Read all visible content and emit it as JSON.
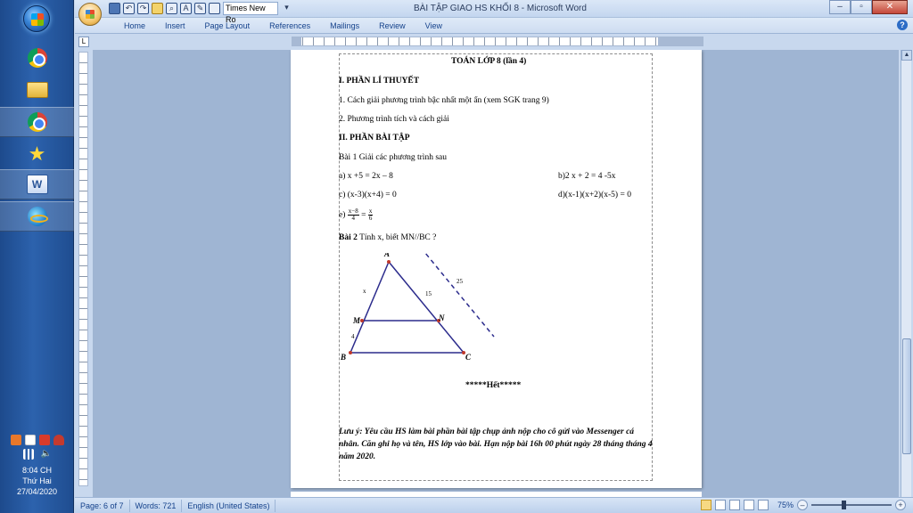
{
  "taskbar": {
    "clock": {
      "time": "8:04 CH",
      "day": "Thứ Hai",
      "date": "27/04/2020"
    }
  },
  "word": {
    "title": "BÀI TẬP GIAO HS KHỐI 8 - Microsoft Word",
    "font_name": "Times New Ro",
    "menu": [
      "Home",
      "Insert",
      "Page Layout",
      "References",
      "Mailings",
      "Review",
      "View"
    ],
    "status": {
      "page": "Page: 6 of 7",
      "words": "Words: 721",
      "language": "English (United States)",
      "zoom": "75%"
    }
  },
  "document": {
    "heading": "TOÁN LỚP 8 (lần 4)",
    "sec1": "I. PHẦN LÍ THUYẾT",
    "t1": "1. Cách giải phương trình bậc nhất một ẩn (xem SGK trang 9)",
    "t2": "2. Phương trình tích và cách  giải",
    "sec2": "II. PHẦN BÀI TẬP",
    "bai1": "Bài 1 Giải các phương trình sau",
    "a": "a) x +5  = 2x – 8",
    "b": "b)2 x + 2 = 4 -5x",
    "c": "c) (x-3)(x+4) = 0",
    "d": "d)(x-1)(x+2)(x-5) = 0",
    "e_prefix": "e)",
    "e_num1": "x−8",
    "e_den1": "4",
    "e_eq": "=",
    "e_num2": "x",
    "e_den2": "6",
    "bai2_label": "Bài 2",
    "bai2_text": " Tính x, biết MN//BC ?",
    "fig": {
      "A": "A",
      "B": "B",
      "C": "C",
      "M": "M",
      "N": "N",
      "x": "x",
      "n15": "15",
      "n4": "4",
      "n25": "25"
    },
    "end": "*****Hết*****",
    "note": "Lưu ý: Yêu cầu HS làm bài phần bài tập chụp ảnh nộp cho cô gửi vào Messenger cá nhân. Căn ghi họ và tên, HS lớp vào bài. Hạn nộp bài 16h 00 phút ngày 28  tháng tháng 4 năm 2020."
  }
}
